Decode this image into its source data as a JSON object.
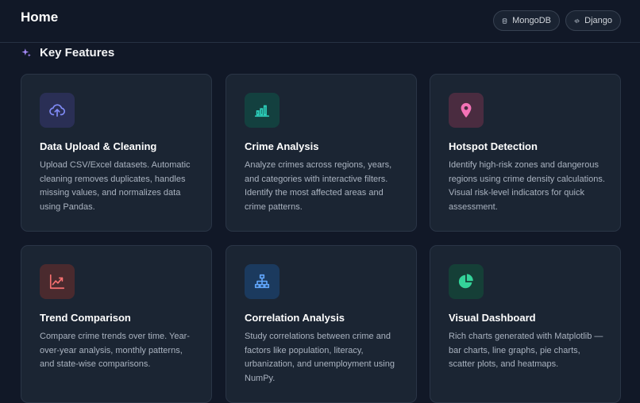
{
  "header": {
    "title": "Home",
    "tags": [
      {
        "label": "MongoDB",
        "icon": "database-icon"
      },
      {
        "label": "Django",
        "icon": "code-icon"
      }
    ]
  },
  "section": {
    "title": "Key Features",
    "icon": "sparkles-icon"
  },
  "features": [
    {
      "title": "Data Upload & Cleaning",
      "description": "Upload CSV/Excel datasets. Automatic cleaning removes duplicates, handles missing values, and normalizes data using Pandas.",
      "icon": "cloud-upload-icon",
      "accent": "#818cf8"
    },
    {
      "title": "Crime Analysis",
      "description": "Analyze crimes across regions, years, and categories with interactive filters. Identify the most affected areas and crime patterns.",
      "icon": "bar-chart-icon",
      "accent": "#2dd4bf"
    },
    {
      "title": "Hotspot Detection",
      "description": "Identify high-risk zones and dangerous regions using crime density calculations. Visual risk-level indicators for quick assessment.",
      "icon": "map-pin-icon",
      "accent": "#f472b6"
    },
    {
      "title": "Trend Comparison",
      "description": "Compare crime trends over time. Year-over-year analysis, monthly patterns, and state-wise comparisons.",
      "icon": "trending-up-icon",
      "accent": "#f87171"
    },
    {
      "title": "Correlation Analysis",
      "description": "Study correlations between crime and factors like population, literacy, urbanization, and unemployment using NumPy.",
      "icon": "network-icon",
      "accent": "#60a5fa"
    },
    {
      "title": "Visual Dashboard",
      "description": "Rich charts generated with Matplotlib — bar charts, line graphs, pie charts, scatter plots, and heatmaps.",
      "icon": "pie-chart-icon",
      "accent": "#34d399"
    }
  ],
  "colors": {
    "background": "#111827",
    "card": "#1b2533",
    "border": "#2a3546"
  }
}
